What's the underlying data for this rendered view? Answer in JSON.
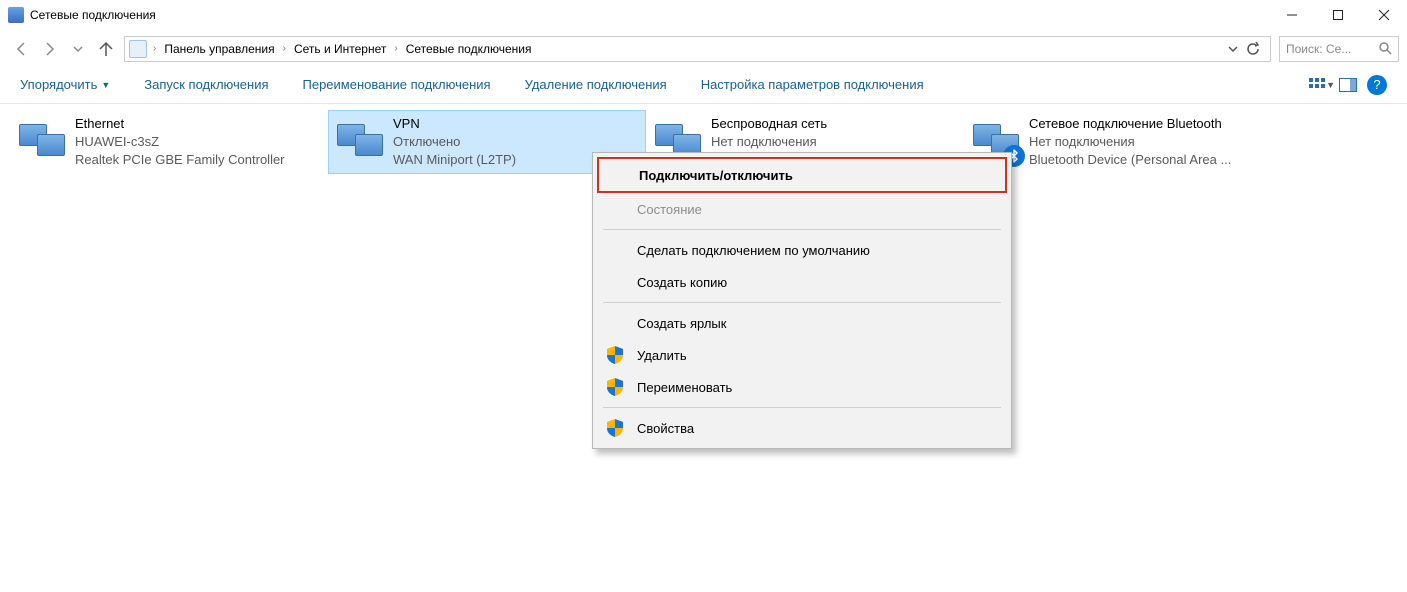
{
  "titlebar": {
    "title": "Сетевые подключения"
  },
  "breadcrumb": {
    "root": "Панель управления",
    "mid": "Сеть и Интернет",
    "leaf": "Сетевые подключения"
  },
  "search": {
    "placeholder": "Поиск: Се..."
  },
  "commands": {
    "organize": "Упорядочить",
    "start": "Запуск подключения",
    "rename": "Переименование подключения",
    "delete": "Удаление подключения",
    "settings": "Настройка параметров подключения"
  },
  "connections": [
    {
      "name": "Ethernet",
      "status": "HUAWEI-c3sZ",
      "device": "Realtek PCIe GBE Family Controller"
    },
    {
      "name": "VPN",
      "status": "Отключено",
      "device": "WAN Miniport (L2TP)"
    },
    {
      "name": "Беспроводная сеть",
      "status": "Нет подключения",
      "device": ""
    },
    {
      "name": "Сетевое подключение Bluetooth",
      "status": "Нет подключения",
      "device": "Bluetooth Device (Personal Area ..."
    }
  ],
  "context_menu": {
    "connect": "Подключить/отключить",
    "status": "Состояние",
    "set_default": "Сделать подключением по умолчанию",
    "copy": "Создать копию",
    "shortcut": "Создать ярлык",
    "delete": "Удалить",
    "rename": "Переименовать",
    "properties": "Свойства"
  }
}
